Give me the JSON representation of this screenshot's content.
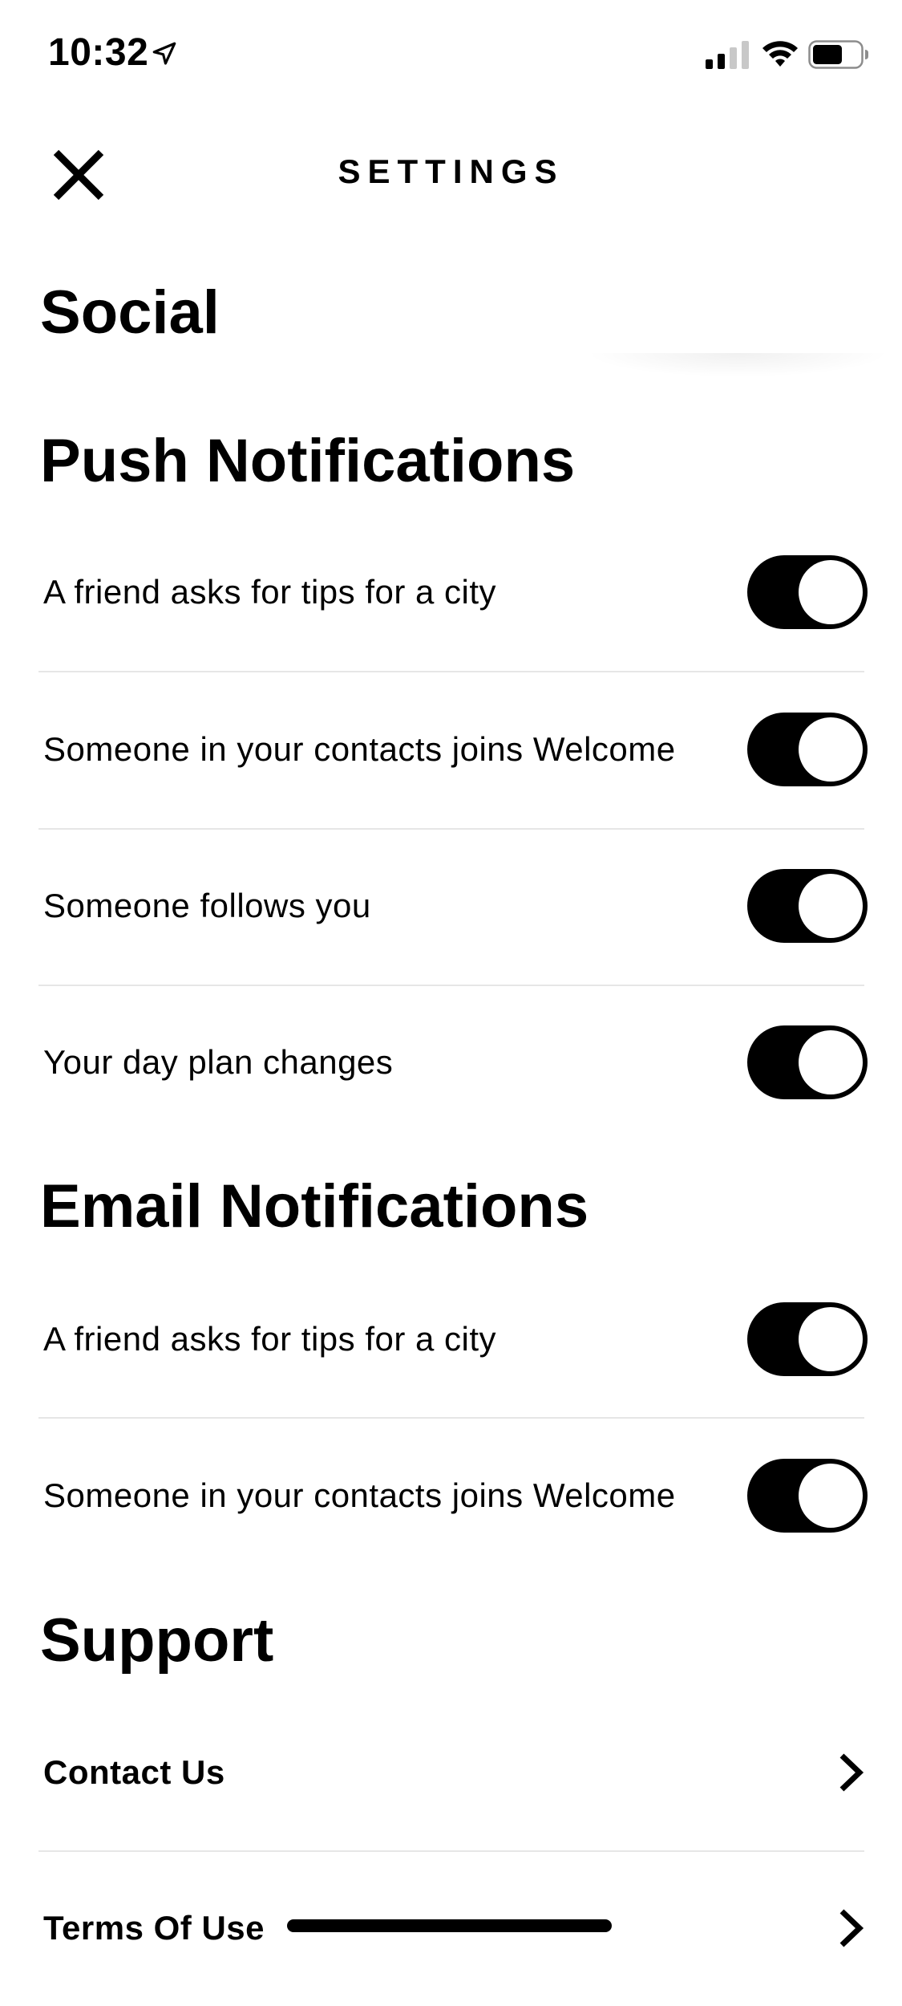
{
  "status_bar": {
    "time": "10:32",
    "icons": [
      "location-arrow-icon",
      "cellular-signal-icon",
      "wifi-icon",
      "battery-icon"
    ]
  },
  "header": {
    "title": "SETTINGS",
    "close_icon": "close-icon"
  },
  "sections": {
    "social": {
      "heading": "Social"
    },
    "push": {
      "heading": "Push Notifications",
      "items": [
        {
          "label": "A friend asks for tips for a city",
          "enabled": true
        },
        {
          "label": "Someone in your contacts joins Welcome",
          "enabled": true
        },
        {
          "label": "Someone follows you",
          "enabled": true
        },
        {
          "label": "Your day plan changes",
          "enabled": true
        }
      ]
    },
    "email": {
      "heading": "Email Notifications",
      "items": [
        {
          "label": "A friend asks for tips for a city",
          "enabled": true
        },
        {
          "label": "Someone in your contacts joins Welcome",
          "enabled": true
        }
      ]
    },
    "support": {
      "heading": "Support",
      "items": [
        {
          "label": "Contact Us"
        },
        {
          "label": "Terms Of Use"
        }
      ]
    }
  },
  "colors": {
    "toggle_on": "#000000",
    "divider": "#e6e6e6",
    "background": "#ffffff"
  }
}
